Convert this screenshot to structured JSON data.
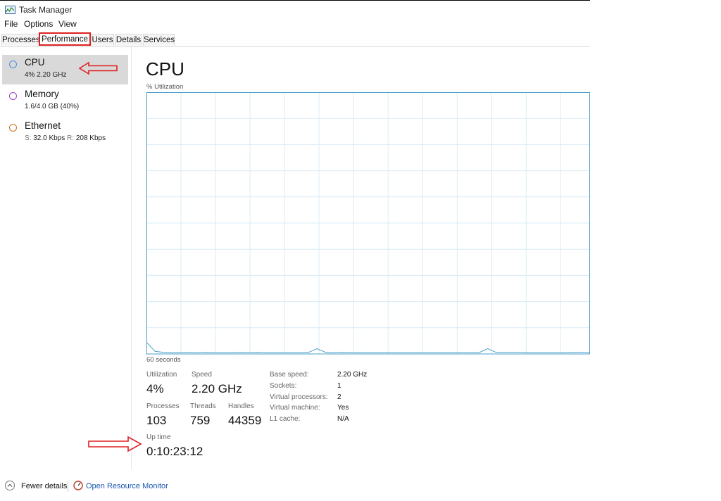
{
  "app": {
    "title": "Task Manager"
  },
  "menu": [
    "File",
    "Options",
    "View"
  ],
  "tabs": [
    "Processes",
    "Performance",
    "Users",
    "Details",
    "Services"
  ],
  "sidebar": {
    "items": [
      {
        "title": "CPU",
        "sub": "4%  2.20 GHz",
        "color": "#4a90d9",
        "selected": true
      },
      {
        "title": "Memory",
        "sub": "1.6/4.0 GB (40%)",
        "color": "#a040c0"
      },
      {
        "title": "Ethernet",
        "sub_s_label": "S:",
        "sub_s": " 32.0 Kbps ",
        "sub_r_label": "R:",
        "sub_r": " 208 Kbps",
        "color": "#c87020"
      }
    ]
  },
  "cpu": {
    "title": "CPU",
    "graph_label": "% Utilization",
    "time_label": "60 seconds",
    "graph_color": "#4a9dc9",
    "graph_values": [
      4.5,
      1,
      0.6,
      0.5,
      0.5,
      0.6,
      0.5,
      0.6,
      0.5,
      0.5,
      0.5,
      0.6,
      0.5,
      0.6,
      0.5,
      0.5,
      0.5,
      0.5,
      0.5,
      0.6,
      2,
      0.6,
      0.5,
      0.6,
      0.5,
      0.5,
      0.5,
      0.5,
      0.5,
      0.5,
      0.5,
      0.5,
      0.5,
      0.5,
      0.5,
      0.5,
      0.5,
      0.5,
      0.5,
      0.5,
      2,
      0.6,
      0.6,
      0.6,
      0.6,
      0.5,
      0.5,
      0.5,
      0.5,
      0.5,
      0.6,
      0.6,
      0.5
    ]
  },
  "stats": {
    "utilization_label": "Utilization",
    "utilization": "4%",
    "speed_label": "Speed",
    "speed": "2.20 GHz",
    "processes_label": "Processes",
    "processes": "103",
    "threads_label": "Threads",
    "threads": "759",
    "handles_label": "Handles",
    "handles": "44359",
    "uptime_label": "Up time",
    "uptime": "0:10:23:12"
  },
  "info": [
    {
      "label": "Base speed:",
      "value": "2.20 GHz"
    },
    {
      "label": "Sockets:",
      "value": "1"
    },
    {
      "label": "Virtual processors:",
      "value": "2"
    },
    {
      "label": "Virtual machine:",
      "value": "Yes"
    },
    {
      "label": "L1 cache:",
      "value": "N/A"
    }
  ],
  "footer": {
    "fewer": "Fewer details",
    "resmon": "Open Resource Monitor"
  },
  "annotation_color": "#e02020"
}
